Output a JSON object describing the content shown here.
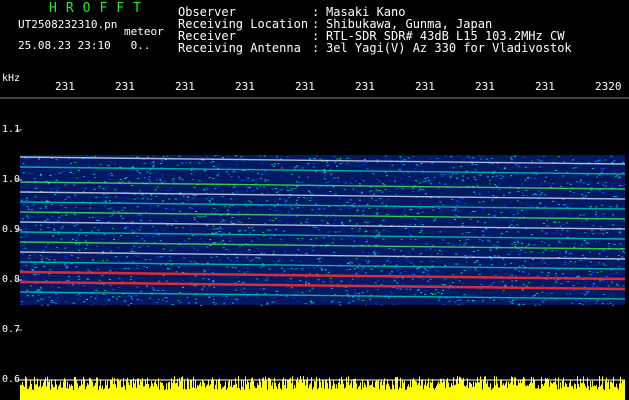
{
  "header": {
    "brand": "HROFFT",
    "file_name": "UT2508232310.pn",
    "tag": "meteor",
    "timestamp": "25.08.23 23:10",
    "count": "0.."
  },
  "info": [
    {
      "label": "Observer",
      "value": "Masaki Kano"
    },
    {
      "label": "Receiving Location",
      "value": "Shibukawa, Gunma, Japan"
    },
    {
      "label": "Receiver",
      "value": "RTL-SDR SDR# 43dB L15 103.2MHz CW"
    },
    {
      "label": "Receiving Antenna",
      "value": "3el Yagi(V) Az 330 for Vladivostok"
    }
  ],
  "chart_data": {
    "type": "heatmap",
    "ylabel": "kHz",
    "x_tick_labels": [
      "231",
      "231",
      "231",
      "231",
      "231",
      "231",
      "231",
      "231",
      "231",
      "2320"
    ],
    "y_tick_labels": [
      "1.1",
      "1.0",
      "0.9",
      "0.8",
      "0.7",
      "0.6"
    ],
    "ylim": [
      0.6,
      1.1
    ],
    "signal_band_khz": [
      0.75,
      1.05
    ],
    "trails_khz": [
      1.04,
      1.02,
      0.99,
      0.97,
      0.95,
      0.93,
      0.91,
      0.89,
      0.87,
      0.85,
      0.83,
      0.81,
      0.79,
      0.77
    ],
    "noise_floor_color": "#ffff00",
    "background_color": "#000000"
  }
}
